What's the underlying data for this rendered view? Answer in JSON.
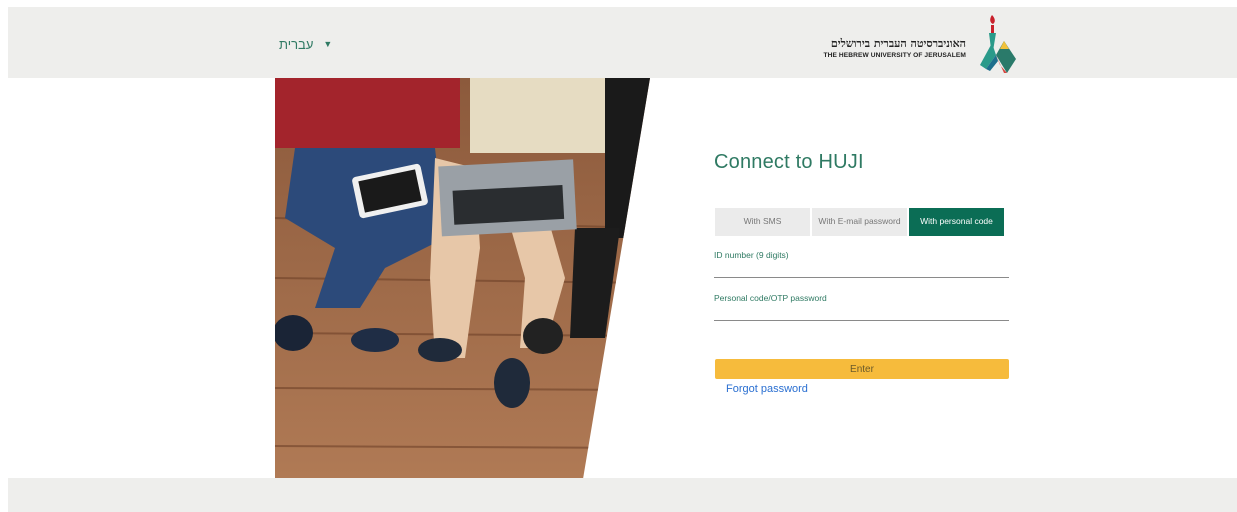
{
  "header": {
    "language_label": "עברית",
    "logo_hebrew": "האוניברסיטה העברית בירושלים",
    "logo_english": "THE HEBREW UNIVERSITY OF JERUSALEM"
  },
  "login": {
    "title": "Connect to HUJI",
    "tabs": [
      {
        "label": "With SMS",
        "active": false
      },
      {
        "label": "With E-mail password",
        "active": false
      },
      {
        "label": "With personal code",
        "active": true
      }
    ],
    "id_field_label": "ID number (9 digits)",
    "id_field_value": "",
    "code_field_label": "Personal code/OTP password",
    "code_field_value": "",
    "enter_label": "Enter",
    "forgot_label": "Forgot password"
  },
  "colors": {
    "brand_green": "#0b6d55",
    "accent_yellow": "#f6bb3c",
    "link_blue": "#2a6fd1",
    "header_bg": "#eeeeec"
  },
  "icons": {
    "language_chevron": "chevron-down-icon",
    "logo": "university-logo"
  }
}
